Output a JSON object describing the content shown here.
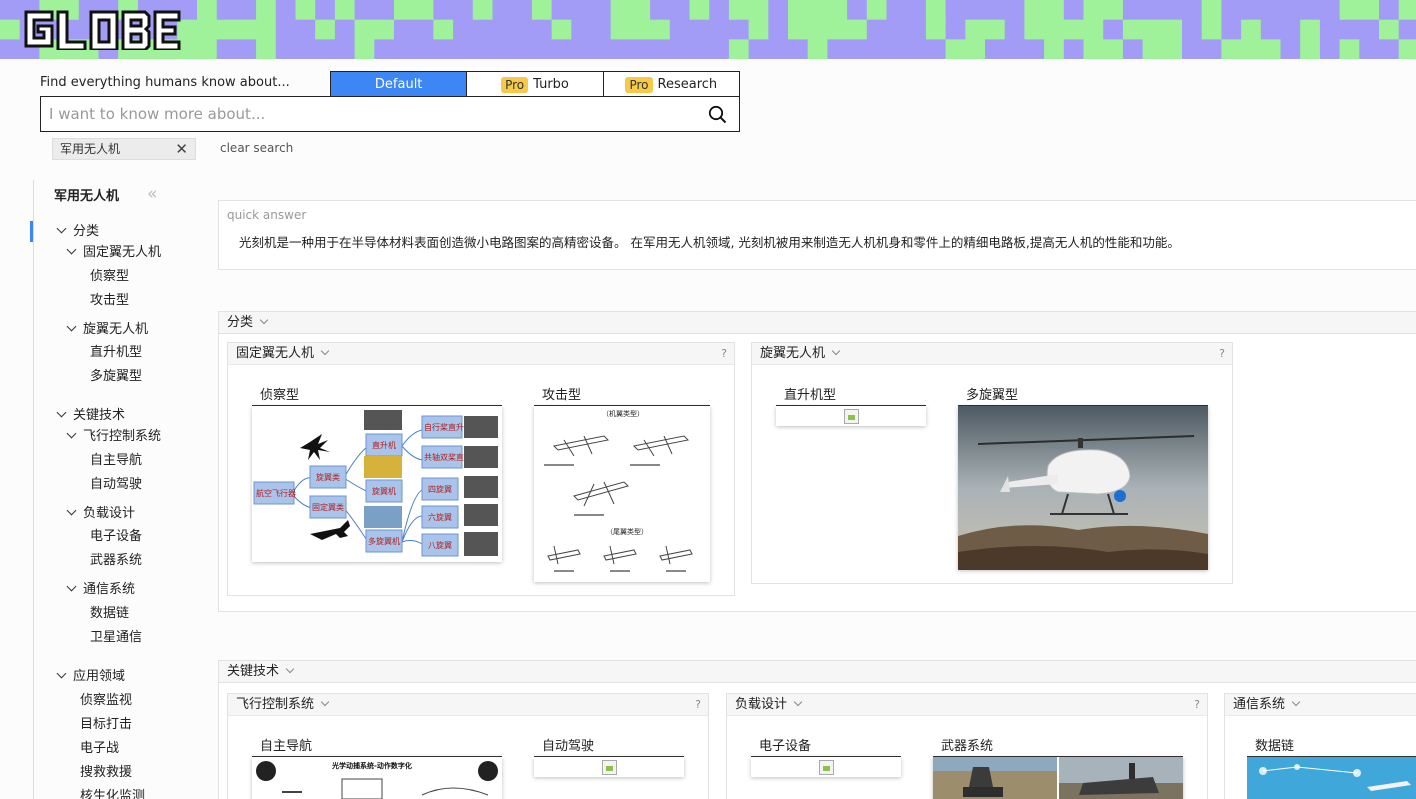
{
  "header": {
    "logo_text": "GLOBE"
  },
  "search": {
    "tagline": "Find everything humans know about...",
    "modes": [
      {
        "label": "Default",
        "pro": "",
        "active": true
      },
      {
        "label": "Turbo",
        "pro": "Pro",
        "active": false
      },
      {
        "label": "Research",
        "pro": "Pro",
        "active": false
      }
    ],
    "placeholder": "I want to know more about...",
    "chip": "军用无人机",
    "clear_label": "clear search"
  },
  "sidebar": {
    "title": "军用无人机",
    "items": [
      {
        "label": "分类",
        "level": 0,
        "chevron": true
      },
      {
        "label": "固定翼无人机",
        "level": 1,
        "chevron": true
      },
      {
        "label": "侦察型",
        "level": 2
      },
      {
        "label": "攻击型",
        "level": 2
      },
      {
        "label": "旋翼无人机",
        "level": 1,
        "chevron": true
      },
      {
        "label": "直升机型",
        "level": 2
      },
      {
        "label": "多旋翼型",
        "level": 2
      },
      {
        "label": "关键技术",
        "level": 0,
        "chevron": true
      },
      {
        "label": "飞行控制系统",
        "level": 1,
        "chevron": true
      },
      {
        "label": "自主导航",
        "level": 2
      },
      {
        "label": "自动驾驶",
        "level": 2
      },
      {
        "label": "负载设计",
        "level": 1,
        "chevron": true
      },
      {
        "label": "电子设备",
        "level": 2
      },
      {
        "label": "武器系统",
        "level": 2
      },
      {
        "label": "通信系统",
        "level": 1,
        "chevron": true
      },
      {
        "label": "数据链",
        "level": 2
      },
      {
        "label": "卫星通信",
        "level": 2
      },
      {
        "label": "应用领域",
        "level": 0,
        "chevron": true
      },
      {
        "label": "侦察监视",
        "level": 3
      },
      {
        "label": "目标打击",
        "level": 3
      },
      {
        "label": "电子战",
        "level": 3
      },
      {
        "label": "搜救救援",
        "level": 3
      },
      {
        "label": "核生化监测",
        "level": 3
      }
    ]
  },
  "quick_answer": {
    "label": "quick answer",
    "text": "光刻机是一种用于在半导体材料表面创造微小电路图案的高精密设备。 在军用无人机领域, 光刻机被用来制造无人机机身和零件上的精细电路板,提高无人机的性能和功能。"
  },
  "sections": {
    "classification": {
      "title": "分类",
      "fixed": {
        "title": "固定翼无人机",
        "help": "?",
        "items": [
          "侦察型",
          "攻击型"
        ]
      },
      "rotary": {
        "title": "旋翼无人机",
        "help": "?",
        "items": [
          "直升机型",
          "多旋翼型"
        ]
      }
    },
    "tech": {
      "title": "关键技术",
      "flight": {
        "title": "飞行控制系统",
        "help": "?",
        "items": [
          "自主导航",
          "自动驾驶"
        ]
      },
      "payload": {
        "title": "负载设计",
        "help": "?",
        "items": [
          "电子设备",
          "武器系统"
        ]
      },
      "comm": {
        "title": "通信系统",
        "items": [
          "数据链"
        ]
      }
    }
  },
  "diagram": {
    "root": "航空飞行器",
    "l1": [
      "旋翼类",
      "固定翼类"
    ],
    "l2": [
      "直升机",
      "旋翼机",
      "多旋翼机"
    ],
    "l3": [
      "自行桨直升机",
      "共轴双桨直升机",
      "四旋翼",
      "六旋翼",
      "八旋翼"
    ]
  },
  "wing_diagram": {
    "title1": "（机翼类型）",
    "title2": "（尾翼类型）"
  },
  "nav_diagram": {
    "title": "光学动捕系统-动作数字化"
  },
  "colors": {
    "accent": "#3d86f6",
    "pro": "#f7c948",
    "banner_a": "#a29cf6",
    "banner_b": "#9ff29a"
  }
}
